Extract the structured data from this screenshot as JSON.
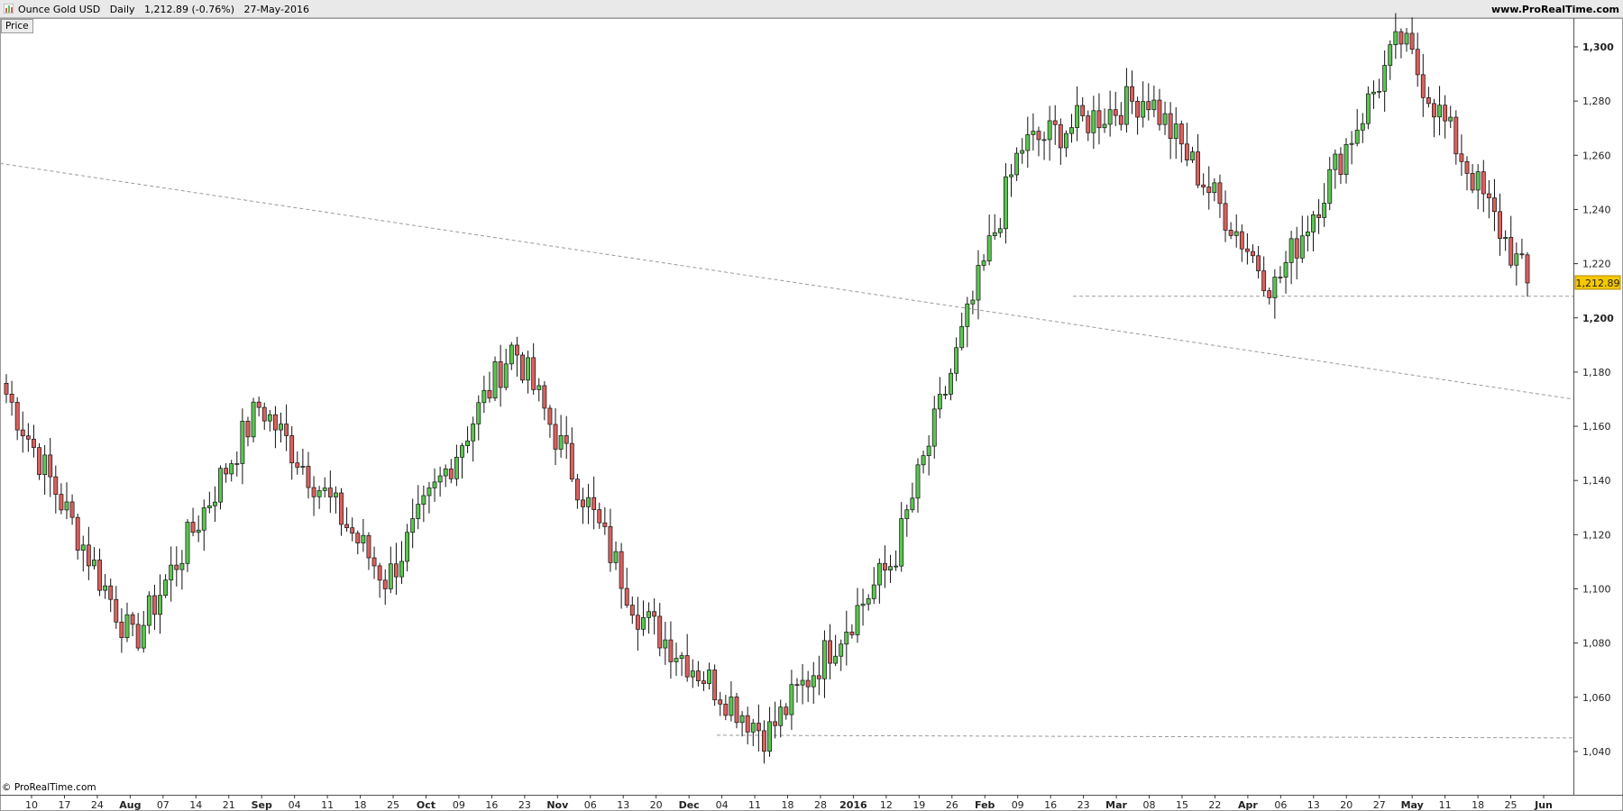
{
  "header": {
    "title": "Ounce Gold USD   Daily   1,212.89 (-0.76%)   27-May-2016",
    "site": "www.ProRealTime.com"
  },
  "price_button": "Price",
  "footer": "© ProRealTime.com",
  "colors": {
    "up": "#5cc452",
    "down": "#d9605e",
    "wick": "#111111",
    "last_badge": "#f5c800"
  },
  "chart_data": {
    "type": "candlestick",
    "ylim": [
      1040,
      1310
    ],
    "y_ticks": [
      1040,
      1060,
      1080,
      1100,
      1120,
      1140,
      1160,
      1180,
      1200,
      1220,
      1240,
      1260,
      1280,
      1300
    ],
    "y_tick_labels": [
      "1,040",
      "1,060",
      "1,080",
      "1,100",
      "1,120",
      "1,140",
      "1,160",
      "1,180",
      "1,200",
      "1,220",
      "1,240",
      "1,260",
      "1,280",
      "1,300"
    ],
    "x_labels": [
      "10",
      "17",
      "24",
      "Aug",
      "07",
      "14",
      "21",
      "Sep",
      "04",
      "11",
      "18",
      "25",
      "Oct",
      "09",
      "16",
      "23",
      "Nov",
      "06",
      "13",
      "20",
      "Dec",
      "04",
      "11",
      "18",
      "28",
      "2016",
      "12",
      "19",
      "26",
      "Feb",
      "09",
      "16",
      "23",
      "Mar",
      "08",
      "15",
      "22",
      "Apr",
      "06",
      "13",
      "20",
      "27",
      "May",
      "11",
      "18",
      "25",
      "Jun"
    ],
    "last_price": "1,212.89",
    "key_points": [
      {
        "date": "Jul-2015",
        "value": 1172
      },
      {
        "date": "late-Jul-2015",
        "value": 1080
      },
      {
        "date": "Aug-2015",
        "value": 1168
      },
      {
        "date": "Sep-2015",
        "value": 1103
      },
      {
        "date": "Oct-2015",
        "value": 1190
      },
      {
        "date": "Nov-2015",
        "value": 1090
      },
      {
        "date": "Dec-2015",
        "value": 1046
      },
      {
        "date": "Jan-2016",
        "value": 1111
      },
      {
        "date": "Feb-2016",
        "value": 1263
      },
      {
        "date": "Mar-2016",
        "value": 1282
      },
      {
        "date": "Apr-2016",
        "value": 1211
      },
      {
        "date": "May-2016",
        "value": 1303
      },
      {
        "date": "27-May-2016",
        "value": 1212.89
      }
    ],
    "lines": [
      {
        "style": "dashed",
        "from": {
          "date": "Jul-2015",
          "value": 1257
        },
        "to": {
          "date": "Jun-2016",
          "value": 1170
        }
      },
      {
        "style": "dashed",
        "from": {
          "date": "Feb-2016",
          "value": 1208
        },
        "to": {
          "date": "Jun-2016",
          "value": 1208
        }
      },
      {
        "style": "dashed",
        "from": {
          "date": "Dec-2015",
          "value": 1046
        },
        "to": {
          "date": "Jun-2016",
          "value": 1045
        }
      }
    ]
  }
}
